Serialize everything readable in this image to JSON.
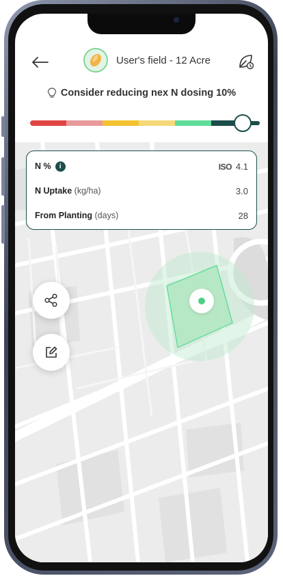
{
  "header": {
    "field_title": "User's field - 12 Acre",
    "back_icon": "arrow-left-icon",
    "field_settings_icon": "leaf-settings-icon"
  },
  "tip": {
    "text": "Consider reducing nex N dosing 10%",
    "icon": "lightbulb-icon"
  },
  "scale": {
    "segment_colors": [
      "#e04545",
      "#e89a9a",
      "#f2c230",
      "#f5d978",
      "#5fdc9a",
      "#1b4d4b"
    ],
    "selected_fraction": 0.97
  },
  "metrics": {
    "n_percent_label": "N %",
    "n_percent_value": "4.1",
    "n_percent_badge": "ISO",
    "uptake_label": "N Uptake",
    "uptake_unit": "(kg/ha)",
    "uptake_value": "3.0",
    "planting_label": "From Planting",
    "planting_unit": "(days)",
    "planting_value": "28"
  },
  "actions": {
    "share_icon": "share-icon",
    "edit_icon": "edit-icon"
  },
  "colors": {
    "accent": "#1b4d4b",
    "field_green": "#5fdc9a"
  }
}
